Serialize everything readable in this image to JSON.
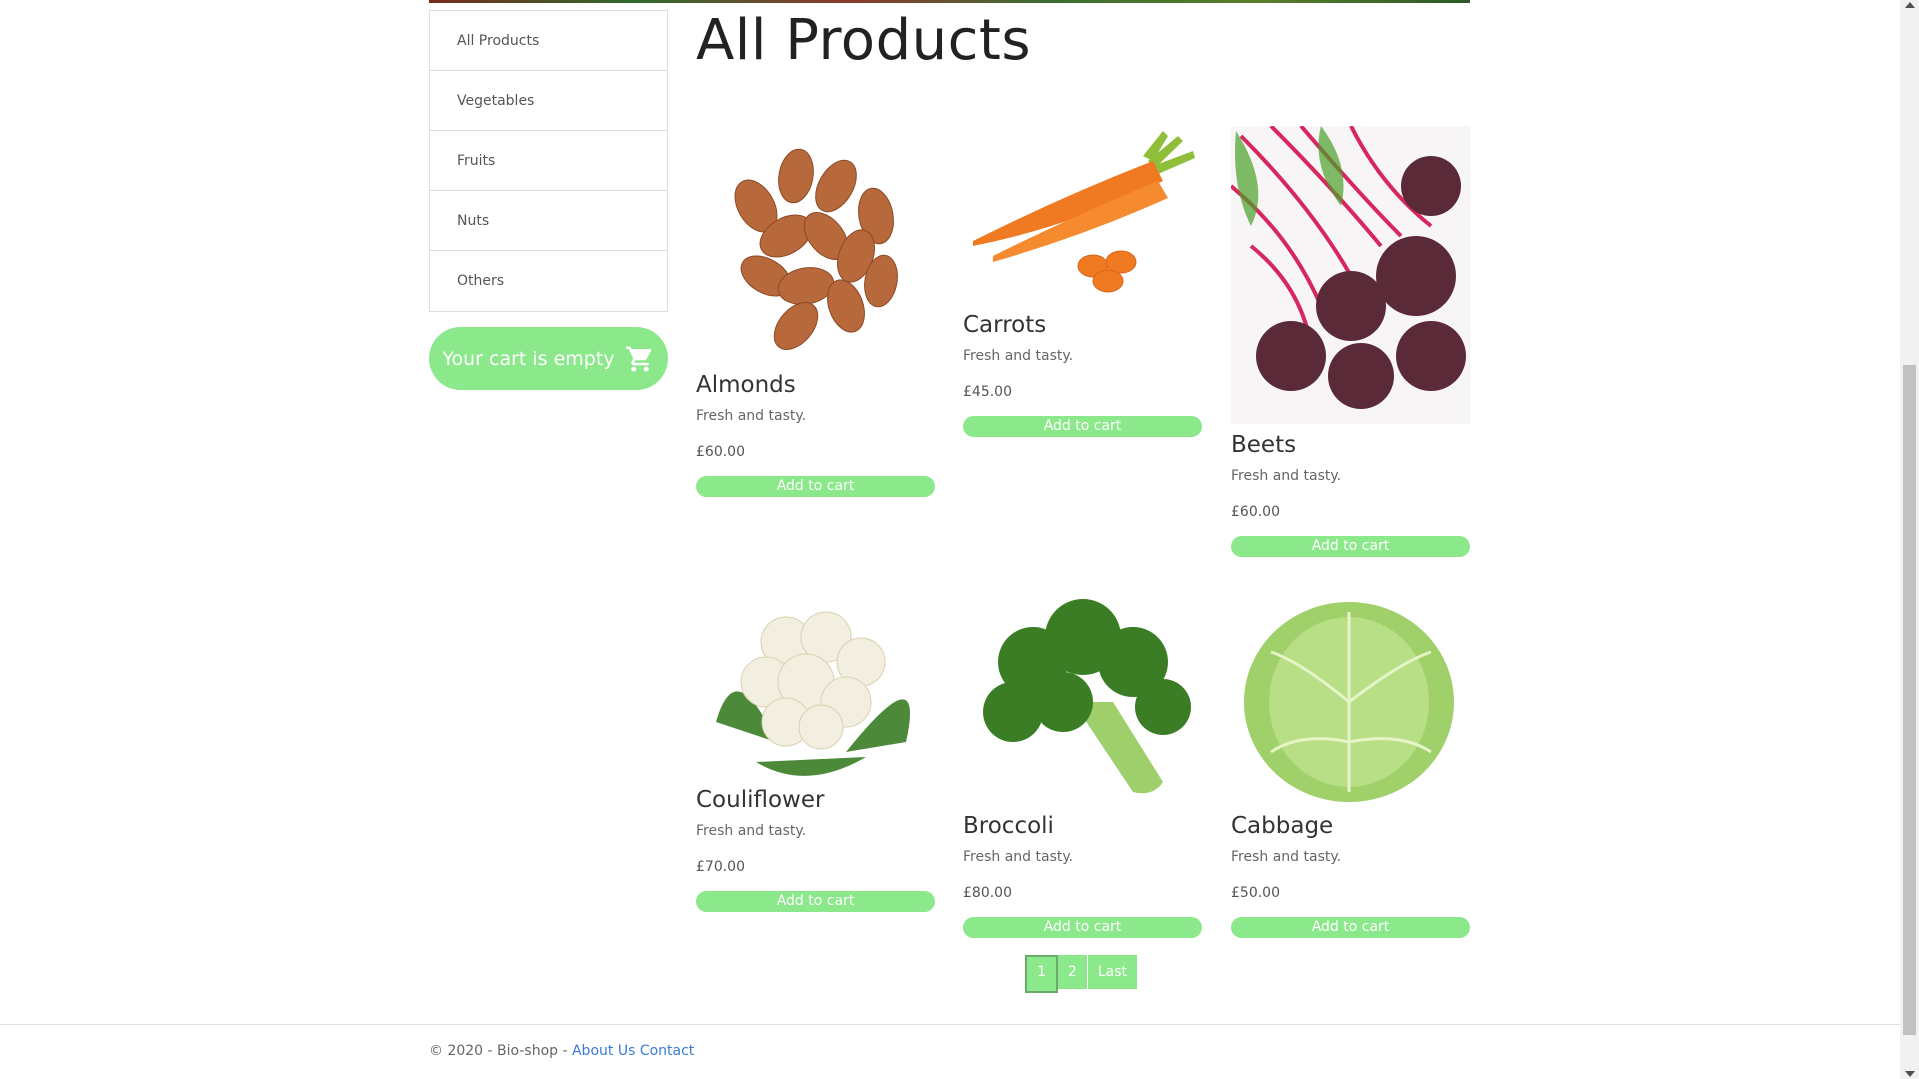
{
  "sidebar": {
    "categories": [
      "All Products",
      "Vegetables",
      "Fruits",
      "Nuts",
      "Others"
    ],
    "cart_label": "Your cart is empty",
    "cart_icon": "shopping-cart-icon"
  },
  "main": {
    "title": "All Products",
    "products": [
      {
        "name": "Almonds",
        "description": "Fresh and tasty.",
        "price": "£60.00",
        "button": "Add to cart"
      },
      {
        "name": "Carrots",
        "description": "Fresh and tasty.",
        "price": "£45.00",
        "button": "Add to cart"
      },
      {
        "name": "Beets",
        "description": "Fresh and tasty.",
        "price": "£60.00",
        "button": "Add to cart"
      },
      {
        "name": "Couliflower",
        "description": "Fresh and tasty.",
        "price": "£70.00",
        "button": "Add to cart"
      },
      {
        "name": "Broccoli",
        "description": "Fresh and tasty.",
        "price": "£80.00",
        "button": "Add to cart"
      },
      {
        "name": "Cabbage",
        "description": "Fresh and tasty.",
        "price": "£50.00",
        "button": "Add to cart"
      }
    ]
  },
  "pagination": {
    "pages": [
      "1",
      "2",
      "Last"
    ],
    "current": "1"
  },
  "footer": {
    "copyright": "© 2020 - Bio-shop - ",
    "about": "About Us",
    "contact": "Contact"
  },
  "colors": {
    "accent": "#8be88b",
    "link": "#3a7bd5"
  }
}
